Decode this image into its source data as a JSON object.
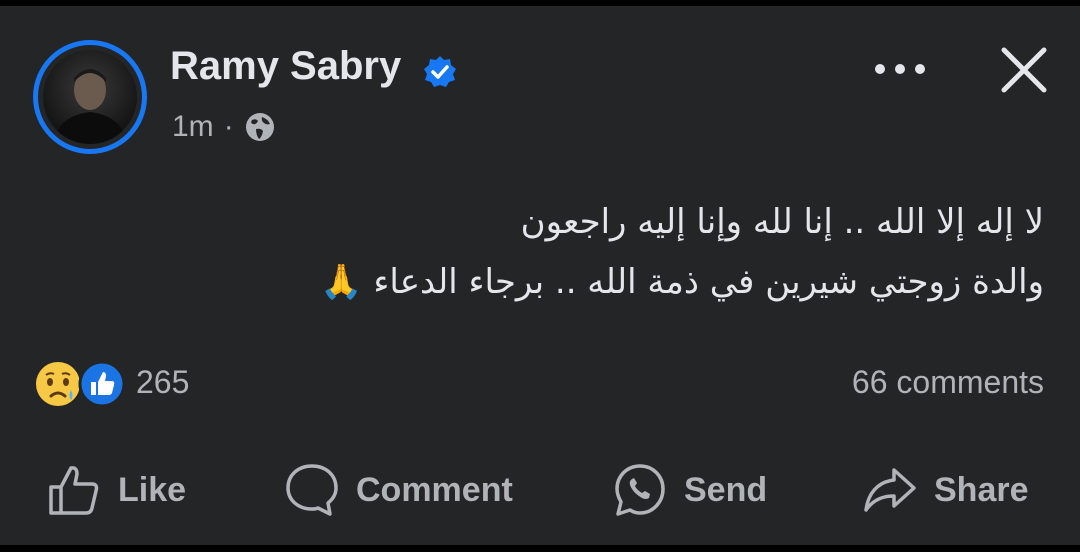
{
  "post": {
    "author": "Ramy Sabry",
    "time": "1m",
    "separator": "·",
    "verified": true,
    "lines": [
      "لا إله إلا الله .. إنا لله وإنا إليه راجعون",
      "والدة زوجتي شيرين في ذمة الله .. برجاء الدعاء 🙏"
    ]
  },
  "stats": {
    "reactions_count": "265",
    "comments": "66 comments"
  },
  "actions": {
    "like": "Like",
    "comment": "Comment",
    "send": "Send",
    "share": "Share"
  },
  "colors": {
    "background": "#242526",
    "text": "#e4e6eb",
    "secondary": "#b0b3b8",
    "accent": "#1877f2"
  },
  "icons": [
    "verified-badge-icon",
    "globe-icon",
    "more-icon",
    "close-icon",
    "sad-reaction-icon",
    "like-reaction-icon",
    "like-icon",
    "comment-icon",
    "send-icon",
    "share-icon"
  ]
}
